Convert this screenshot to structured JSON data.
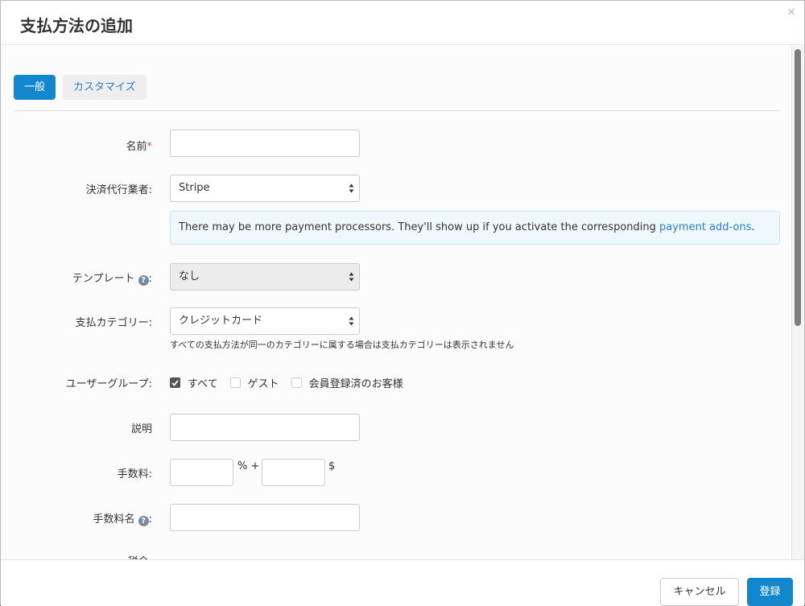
{
  "modal": {
    "title": "支払方法の追加",
    "close_label": "×"
  },
  "tabs": [
    {
      "label": "一般",
      "active": true
    },
    {
      "label": "カスタマイズ",
      "active": false
    }
  ],
  "form": {
    "name": {
      "label": "名前",
      "required_mark": "*",
      "value": ""
    },
    "processor": {
      "label": "決済代行業者:",
      "selected": "Stripe"
    },
    "processor_alert": {
      "text": "There may be more payment processors. They'll show up if you activate the corresponding ",
      "link": "payment add-ons",
      "after": "."
    },
    "template": {
      "label": "テンプレート",
      "help_icon": "?",
      "colon": ":",
      "selected": "なし"
    },
    "category": {
      "label": "支払カテゴリー:",
      "selected": "クレジットカード",
      "hint": "すべての支払方法が同一のカテゴリーに属する場合は支払カテゴリーは表示されません"
    },
    "user_groups": {
      "label": "ユーザーグループ:",
      "options": [
        {
          "label": "すべて",
          "checked": true
        },
        {
          "label": "ゲスト",
          "checked": false
        },
        {
          "label": "会員登録済のお客様",
          "checked": false
        }
      ]
    },
    "description": {
      "label": "説明",
      "value": ""
    },
    "fee": {
      "label": "手数料:",
      "percent_value": "",
      "percent_unit": "% +",
      "fixed_value": "",
      "currency": "$"
    },
    "fee_name": {
      "label": "手数料名",
      "help_icon": "?",
      "colon": ":",
      "value": ""
    },
    "tax": {
      "label": "税金:"
    }
  },
  "footer": {
    "cancel_label": "キャンセル",
    "save_label": "登録"
  },
  "colors": {
    "primary": "#1387cd",
    "link": "#2a7fbf",
    "required": "#d9534f",
    "alert_bg": "#eff8fc"
  }
}
